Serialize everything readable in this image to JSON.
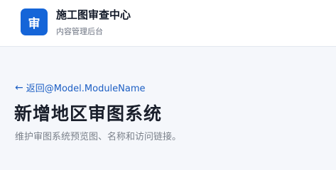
{
  "header": {
    "logo_text": "审",
    "title": "施工图审查中心",
    "subtitle": "内容管理后台"
  },
  "main": {
    "back_icon": "arrow-left-icon",
    "back_label": "返回@Model.ModuleName",
    "page_title": "新增地区审图系统",
    "description": "维护审图系统预览图、名称和访问链接。"
  },
  "colors": {
    "accent": "#1565d8",
    "link": "#1d5fc4",
    "background": "#f5f7fb"
  }
}
